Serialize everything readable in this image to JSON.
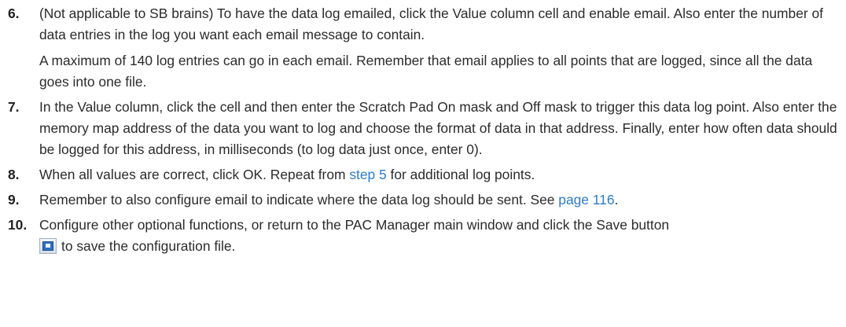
{
  "steps": [
    {
      "number": "6.",
      "paragraphs": [
        "(Not applicable to SB brains) To have the data log emailed, click the Value column cell and enable email. Also enter the number of data entries in the log you want each email message to contain.",
        "A maximum of 140 log entries can go in each email. Remember that email applies to all points that are logged, since all the data goes into one file."
      ]
    },
    {
      "number": "7.",
      "text": "In the Value column, click the cell and then enter the Scratch Pad On mask and Off mask to trigger this data log point. Also enter the memory map address of the data you want to log and choose the format of data in that address. Finally, enter how often data should be logged for this address, in milliseconds (to log data just once, enter 0)."
    },
    {
      "number": "8.",
      "text_before": "When all values are correct, click OK. Repeat from ",
      "link": "step 5",
      "text_after": " for additional log points."
    },
    {
      "number": "9.",
      "text_before": "Remember to also configure email to indicate where the data log should be sent. See ",
      "link": "page 116",
      "text_after": "."
    },
    {
      "number": "10.",
      "text_before": "Configure other optional functions, or return to the PAC Manager main window and click the Save button",
      "icon": "save-icon",
      "text_after": "to save the configuration file."
    }
  ],
  "colors": {
    "text": "#2b2b2b",
    "link": "#2c7cc8"
  }
}
